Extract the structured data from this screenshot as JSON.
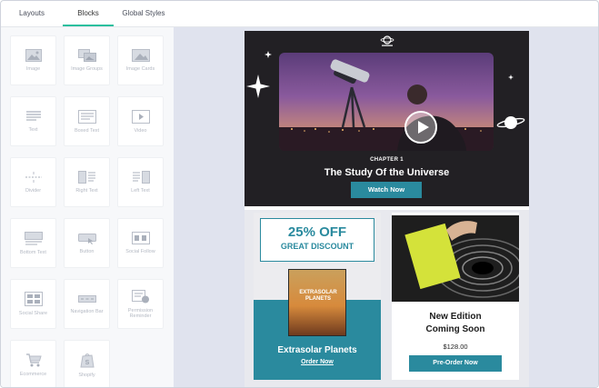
{
  "tabs": [
    {
      "label": "Layouts"
    },
    {
      "label": "Blocks"
    },
    {
      "label": "Global Styles"
    }
  ],
  "active_tab": "Blocks",
  "blocks": [
    {
      "label": "Image",
      "icon": "image-icon"
    },
    {
      "label": "Image Groups",
      "icon": "image-groups-icon"
    },
    {
      "label": "Image Cards",
      "icon": "image-cards-icon"
    },
    {
      "label": "Text",
      "icon": "text-icon"
    },
    {
      "label": "Boxed Text",
      "icon": "boxed-text-icon"
    },
    {
      "label": "Video",
      "icon": "video-icon"
    },
    {
      "label": "Divider",
      "icon": "divider-icon"
    },
    {
      "label": "Right Text",
      "icon": "right-text-icon"
    },
    {
      "label": "Left Text",
      "icon": "left-text-icon"
    },
    {
      "label": "Bottom Text",
      "icon": "bottom-text-icon"
    },
    {
      "label": "Button",
      "icon": "button-icon"
    },
    {
      "label": "Social Follow",
      "icon": "social-follow-icon"
    },
    {
      "label": "Social Share",
      "icon": "social-share-icon"
    },
    {
      "label": "Navigation Bar",
      "icon": "navigation-bar-icon"
    },
    {
      "label": "Permission Reminder",
      "icon": "permission-reminder-icon"
    },
    {
      "label": "Ecommerce",
      "icon": "shopping-cart-icon"
    },
    {
      "label": "Shopify",
      "icon": "shopify-icon"
    }
  ],
  "email": {
    "hero": {
      "chapter": "CHAPTER 1",
      "title": "The Study Of the Universe",
      "button": "Watch Now"
    },
    "offer": {
      "percent": "25% OFF",
      "subtitle": "GREAT DISCOUNT",
      "book_title": "EXTRASOLAR PLANETS",
      "title": "Extrasolar Planets",
      "link": "Order Now"
    },
    "edition": {
      "title_line1": "New Edition",
      "title_line2": "Coming Soon",
      "price": "$128.00",
      "button": "Pre-Order Now"
    }
  },
  "colors": {
    "accent": "#2bbf9e",
    "teal": "#2a8a9e",
    "canvas": "#e0e3ee",
    "hero_bg": "#222024"
  }
}
